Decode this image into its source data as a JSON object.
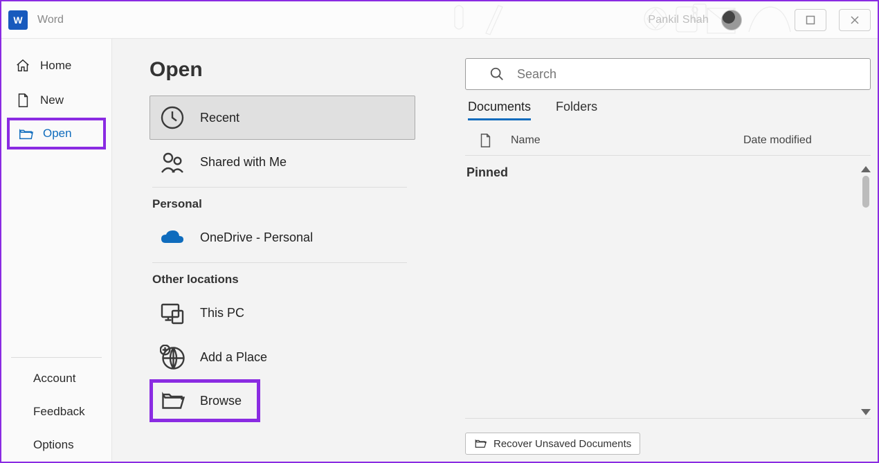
{
  "titlebar": {
    "app_letter": "W",
    "app_name": "Word",
    "user_name": "Pankil Shah"
  },
  "sidebar": {
    "items": [
      {
        "label": "Home"
      },
      {
        "label": "New"
      },
      {
        "label": "Open"
      }
    ],
    "bottom": [
      {
        "label": "Account"
      },
      {
        "label": "Feedback"
      },
      {
        "label": "Options"
      }
    ]
  },
  "page_title": "Open",
  "locations": {
    "top": [
      {
        "label": "Recent"
      },
      {
        "label": "Shared with Me"
      }
    ],
    "personal_heading": "Personal",
    "personal": [
      {
        "label": "OneDrive - Personal"
      }
    ],
    "other_heading": "Other locations",
    "other": [
      {
        "label": "This PC"
      },
      {
        "label": "Add a Place"
      },
      {
        "label": "Browse"
      }
    ]
  },
  "search": {
    "placeholder": "Search"
  },
  "tabs": [
    {
      "label": "Documents"
    },
    {
      "label": "Folders"
    }
  ],
  "columns": {
    "name": "Name",
    "date": "Date modified"
  },
  "section_label": "Pinned",
  "recover_label": "Recover Unsaved Documents"
}
